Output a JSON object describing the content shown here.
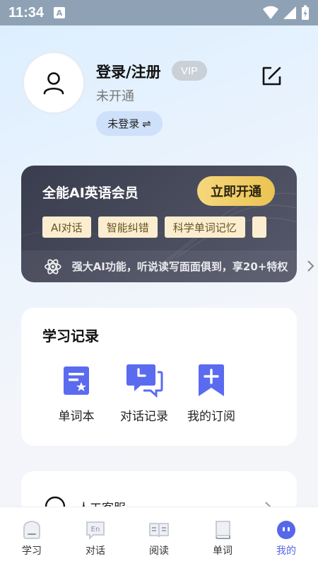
{
  "status_bar": {
    "time": "11:34",
    "notification_letter": "A"
  },
  "profile": {
    "title": "登录/注册",
    "vip_badge": "VIP",
    "status": "未开通",
    "login_chip": "未登录",
    "login_chip_icon": "⇌"
  },
  "vip_card": {
    "title": "全能AI英语会员",
    "open_button": "立即开通",
    "tags": [
      "AI对话",
      "智能纠错",
      "科学单词记忆"
    ],
    "description": "强大AI功能，听说读写面面俱到，享20+特权",
    "accent_color": "#f0cb63"
  },
  "study_record": {
    "title": "学习记录",
    "items": [
      {
        "label": "单词本",
        "icon": "notebook-star-icon"
      },
      {
        "label": "对话记录",
        "icon": "chat-history-icon"
      },
      {
        "label": "我的订阅",
        "icon": "bookmark-plus-icon"
      }
    ],
    "accent_color": "#5b6bf0"
  },
  "service": {
    "label": "人工客服"
  },
  "bottom_nav": {
    "items": [
      {
        "label": "学习",
        "icon": "study-icon"
      },
      {
        "label": "对话",
        "icon": "dialogue-en-icon"
      },
      {
        "label": "阅读",
        "icon": "reading-icon"
      },
      {
        "label": "单词",
        "icon": "word-book-icon"
      },
      {
        "label": "我的",
        "icon": "profile-face-icon"
      }
    ],
    "active_index": 4,
    "active_color": "#5667e8"
  }
}
